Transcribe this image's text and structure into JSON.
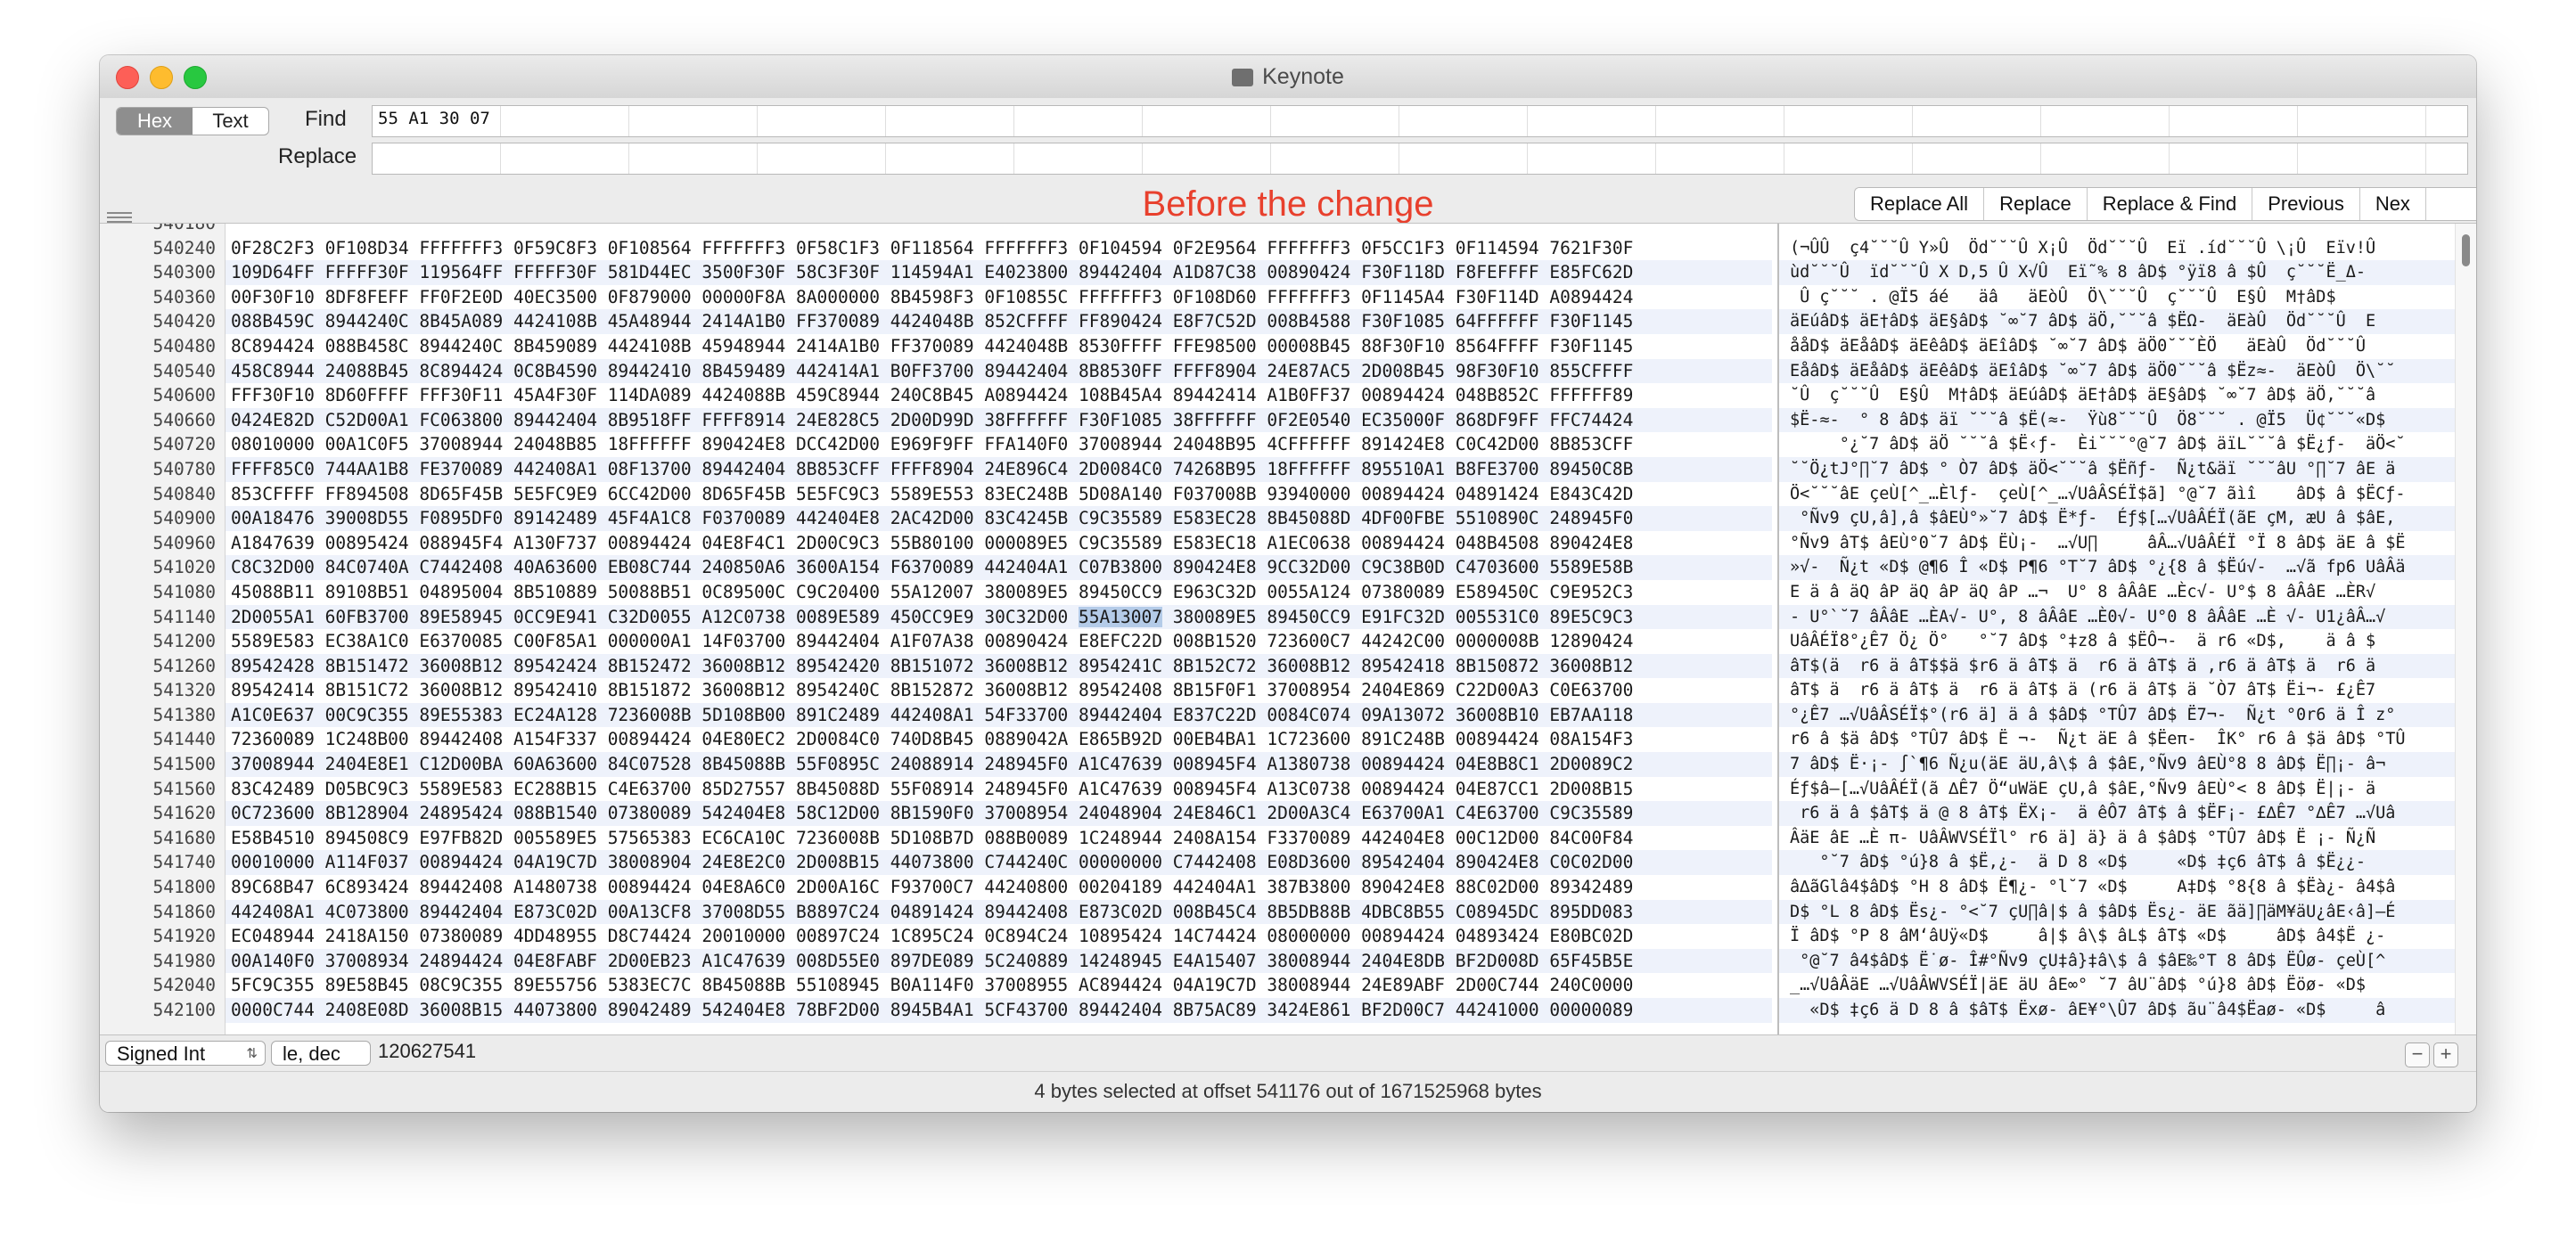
{
  "window": {
    "title": "Keynote"
  },
  "mode_toggle": {
    "hex": "Hex",
    "text": "Text"
  },
  "find": {
    "label": "Find",
    "value": "55 A1 30 07"
  },
  "replace": {
    "label": "Replace",
    "value": ""
  },
  "annotation": "Before the change",
  "actions": {
    "replace_all": "Replace All",
    "replace": "Replace",
    "replace_find": "Replace & Find",
    "previous": "Previous",
    "next": "Nex"
  },
  "hex_view": {
    "first_partial_offset": "540180",
    "offsets": [
      "540240",
      "540300",
      "540360",
      "540420",
      "540480",
      "540540",
      "540600",
      "540660",
      "540720",
      "540780",
      "540840",
      "540900",
      "540960",
      "541020",
      "541080",
      "541140",
      "541200",
      "541260",
      "541320",
      "541380",
      "541440",
      "541500",
      "541560",
      "541620",
      "541680",
      "541740",
      "541800",
      "541860",
      "541920",
      "541980",
      "542040",
      "542100"
    ],
    "hex_rows": [
      "0F28C2F3 0F108D34 FFFFFFF3 0F59C8F3 0F108564 FFFFFFF3 0F58C1F3 0F118564 FFFFFFF3 0F104594 0F2E9564 FFFFFFF3 0F5CC1F3 0F114594 7621F30F",
      "109D64FF FFFFF30F 119564FF FFFFF30F 581D44EC 3500F30F 58C3F30F 114594A1 E4023800 89442404 A1D87C38 00890424 F30F118D F8FEFFFF E85FC62D",
      "00F30F10 8DF8FEFF FF0F2E0D 40EC3500 0F879000 00000F8A 8A000000 8B4598F3 0F10855C FFFFFFF3 0F108D60 FFFFFFF3 0F1145A4 F30F114D A0894424",
      "088B459C 8944240C 8B45A089 4424108B 45A48944 2414A1B0 FF370089 4424048B 852CFFFF FF890424 E8F7C52D 008B4588 F30F1085 64FFFFFF F30F1145",
      "8C894424 088B458C 8944240C 8B459089 4424108B 45948944 2414A1B0 FF370089 4424048B 8530FFFF FFE98500 00008B45 88F30F10 8564FFFF F30F1145",
      "458C8944 24088B45 8C894424 0C8B4590 89442410 8B459489 442414A1 B0FF3700 89442404 8B8530FF FFFF8904 24E87AC5 2D008B45 98F30F10 855CFFFF",
      "FFF30F10 8D60FFFF FFF30F11 45A4F30F 114DA089 4424088B 459C8944 240C8B45 A0894424 108B45A4 89442414 A1B0FF37 00894424 048B852C FFFFFF89",
      "0424E82D C52D00A1 FC063800 89442404 8B9518FF FFFF8914 24E828C5 2D00D99D 38FFFFFF F30F1085 38FFFFFF 0F2E0540 EC35000F 868DF9FF FFC74424",
      "08010000 00A1C0F5 37008944 24048B85 18FFFFFF 890424E8 DCC42D00 E969F9FF FFA140F0 37008944 24048B95 4CFFFFFF 891424E8 C0C42D00 8B853CFF",
      "FFFF85C0 744AA1B8 FE370089 442408A1 08F13700 89442404 8B853CFF FFFF8904 24E896C4 2D0084C0 74268B95 18FFFFFF 895510A1 B8FE3700 89450C8B",
      "853CFFFF FF894508 8D65F45B 5E5FC9E9 6CC42D00 8D65F45B 5E5FC9C3 5589E553 83EC248B 5D08A140 F037008B 93940000 00894424 04891424 E843C42D",
      "00A18476 39008D55 F0895DF0 89142489 45F4A1C8 F0370089 442404E8 2AC42D00 83C4245B C9C35589 E583EC28 8B45088D 4DF00FBE 5510890C 248945F0",
      "A1847639 00895424 088945F4 A130F737 00894424 04E8F4C1 2D00C9C3 55B80100 000089E5 C9C35589 E583EC18 A1EC0638 00894424 048B4508 890424E8",
      "C8C32D00 84C0740A C7442408 40A63600 EB08C744 240850A6 3600A154 F6370089 442404A1 C07B3800 890424E8 9CC32D00 C9C38B0D C4703600 5589E58B",
      "45088B11 89108B51 04895004 8B510889 50088B51 0C89500C C9C20400 55A12007 380089E5 89450CC9 E963C32D 0055A124 07380089 E589450C C9E952C3",
      "2D0055A1 60FB3700 89E58945 0CC9E941 C32D0055 A12C0738 0089E589 450CC9E9 30C32D00 55A13007 380089E5 89450CC9 E91FC32D 005531C0 89E5C9C3",
      "5589E583 EC38A1C0 E6370085 C00F85A1 000000A1 14F03700 89442404 A1F07A38 00890424 E8EFC22D 008B1520 723600C7 44242C00 0000008B 12890424",
      "89542428 8B151472 36008B12 89542424 8B152472 36008B12 89542420 8B151072 36008B12 8954241C 8B152C72 36008B12 89542418 8B150872 36008B12",
      "89542414 8B151C72 36008B12 89542410 8B151872 36008B12 8954240C 8B152872 36008B12 89542408 8B15F0F1 37008954 2404E869 C22D00A3 C0E63700",
      "A1C0E637 00C9C355 89E55383 EC24A128 7236008B 5D108B00 891C2489 442408A1 54F33700 89442404 E837C22D 0084C074 09A13072 36008B10 EB7AA118",
      "72360089 1C248B00 89442408 A154F337 00894424 04E80EC2 2D0084C0 740D8B45 0889042A E865B92D 00EB4BA1 1C723600 891C248B 00894424 08A154F3",
      "37008944 2404E8E1 C12D00BA 60A63600 84C07528 8B45088B 55F0895C 24088914 248945F0 A1C47639 008945F4 A1380738 00894424 04E8B8C1 2D0089C2",
      "83C42489 D05BC9C3 5589E583 EC288B15 C4E63700 85D27557 8B45088D 55F08914 248945F0 A1C47639 008945F4 A13C0738 00894424 04E87CC1 2D008B15",
      "0C723600 8B128904 24895424 088B1540 07380089 542404E8 58C12D00 8B1590F0 37008954 24048904 24E846C1 2D00A3C4 E63700A1 C4E63700 C9C35589",
      "E58B4510 894508C9 E97FB82D 005589E5 57565383 EC6CA10C 7236008B 5D108B7D 088B0089 1C248944 2408A154 F3370089 442404E8 00C12D00 84C00F84",
      "00010000 A114F037 00894424 04A19C7D 38008904 24E8E2C0 2D008B15 44073800 C744240C 00000000 C7442408 E08D3600 89542404 890424E8 C0C02D00",
      "89C68B47 6C893424 89442408 A1480738 00894424 04E8A6C0 2D00A16C F93700C7 44240800 00204189 442404A1 387B3800 890424E8 88C02D00 89342489",
      "442408A1 4C073800 89442404 E873C02D 00A13CF8 37008D55 B8897C24 04891424 89442408 E873C02D 008B45C4 8B5DB88B 4DBC8B55 C08945DC 895DD083",
      "EC048944 2418A150 07380089 4DD48955 D8C74424 20010000 00897C24 1C895C24 0C894C24 10895424 14C74424 08000000 00894424 04893424 E80BC02D",
      "00A140F0 37008934 24894424 04E8FABF 2D00EB23 A1C47639 008D55E0 897DE089 5C240889 14248945 E4A15407 38008944 2404E8DB BF2D008D 65F45B5E",
      "5FC9C355 89E58B45 08C9C355 89E55756 5383EC7C 8B45088B 55108945 B0A114F0 37008955 AC894424 04A19C7D 38008944 24E89ABF 2D00C744 240C0000",
      "0000C744 2408E08D 36008B15 44073800 89042489 542404E8 78BF2D00 8945B4A1 5CF43700 89442404 8B75AC89 3424E861 BF2D00C7 44241000 00000089"
    ],
    "selected_hex": "55A13007",
    "ascii_rows": [
      "(¬ÛÛ  ç4˘˘˘Û Y»Û  Öd˘˘˘Û X¡Û  Öd˘˘˘Û  Eï .íd˘˘˘Û \\¡Û  Eïv!Û",
      "ùd˘˘˘Û  ïd˘˘˘Û X D‚5 Û X√Û  Eï˜% 8 âD$ °ÿï8 â $Û  ç˘˘˘Ë_Δ-",
      " Û ç˘˘˘ . @Ï5 áé   äâ   äEòÛ  Ö\\˘˘˘Û  ç˘˘˘Û  E§Û  M†âD$",
      "äEúâD$ äE†âD$ äE§âD$ ˘∞˘7 âD$ äÖ,˘˘˘â $ËΩ-  äEàÛ  Öd˘˘˘Û  E",
      "ååD$ äEåâD$ äEêâD$ äEîâD$ ˘∞˘7 âD$ äÖ0˘˘˘ÈÖ   äEàÛ  Öd˘˘˘Û",
      "EåâD$ äEåâD$ äEêâD$ äEîâD$ ˘∞˘7 âD$ äÖ0˘˘˘â $Ëz≈-  äEòÛ  Ö\\˘˘",
      "˘Û  ç˘˘˘Û  E§Û  M†âD$ äEúâD$ äE†âD$ äE§âD$ ˘∞˘7 âD$ äÖ,˘˘˘â",
      "$Ë-≈-  ° 8 âD$ äï ˘˘˘â $Ë(≈-  Ÿù8˘˘˘Û  Ö8˘˘˘ . @Ï5  Ü¢˘˘˘«D$",
      "     °¿˘7 âD$ äÖ ˘˘˘â $Ë‹ƒ-  Èi˘˘˘°@˘7 âD$ äïL˘˘˘â $Ë¿ƒ-  äÖ<˘",
      "˘˘Ö¿tJ°∏˘7 âD$ ° Ò7 âD$ äÖ<˘˘˘â $Ëñƒ-  Ñ¿t&äï ˘˘˘âU °∏˘7 âE ä",
      "Ö<˘˘˘âE çeÙ[^_…Èlƒ-  çeÙ[^_…√UâÂSÉÏ$ã] °@˘7 ãìî    âD$ â $ËCƒ-",
      " °Ñv9 çU‚â]‚â $âEÙ°»˘7 âD$ Ë*ƒ-  Éƒ$[…√UâÂÉÏ(ãE çM‚ æU â $âE‚",
      "°Ñv9 âT$ âEÙ°0˘7 âD$ ËÙ¡-  …√U∏     âÂ…√UâÂÉÏ °Ï 8 âD$ äE â $Ë",
      "»√-  Ñ¿t «D$ @¶6 Î «D$ P¶6 °T˘7 âD$ °¿{8 â $Ëú√-  …√ã fp6 UâÂä",
      "E ä â äQ âP äQ âP äQ âP …¬  U° 8 âÂâE …Èc√- U°$ 8 âÂâE …ÈR√",
      "- U°`˘7 âÂâE …ÈA√- U°, 8 âÂâE …È0√- U°0 8 âÂâE …È √- U1¿âÂ…√",
      "UâÂÉÏ8°¿Ê7 Ö¿ Ö°   °˘7 âD$ °‡z8 â $ËÔ¬-  ä r6 «D$,    ä â $",
      "âT$(ä  r6 ä âT$$ä $r6 ä âT$ ä  r6 ä âT$ ä ,r6 ä âT$ ä  r6 ä",
      "âT$ ä  r6 ä âT$ ä  r6 ä âT$ ä (r6 ä âT$ ä ˘Ò7 âT$ Ëi¬- £¿Ê7",
      "°¿Ê7 …√UâÂSÉÏ$°(r6 ä] ä â $âD$ °TÛ7 âD$ Ë7¬-  Ñ¿t °0r6 ä Î z°",
      "r6 â $ä âD$ °TÛ7 âD$ Ë ¬-  Ñ¿t äE â $Ëeπ-  ÎK° r6 â $ä âD$ °TÛ",
      "7 âD$ Ë·¡- ∫`¶6 Ñ¿u(äE äU‚â\\$ â $âE‚°Ñv9 âEÙ°8 8 âD$ Ë∏¡- â¬",
      "Éƒ$â–[…√UâÂÉÏ(ã ∆Ê7 Ö“uWäE çU‚â $âE‚°Ñv9 âEÙ°< 8 âD$ Ë|¡- ä",
      " r6 ä â $âT$ ä @ 8 âT$ ËX¡-  ä êÔ7 âT$ â $ËF¡- £∆Ê7 °∆Ê7 …√Uâ",
      "ÂäE âE …È π- UâÂWVSÉÏl° r6 ä] ä} ä â $âD$ °TÛ7 âD$ Ë ¡- Ñ¿Ñ",
      "   °˘7 âD$ °ú}8 â $Ë‚¿-  ä D 8 «D$     «D$ ‡ç6 âT$ â $Ë¿¿-",
      "â∆ãGlâ4$âD$ °H 8 âD$ Ë¶¿- °l˘7 «D$     A‡D$ °8{8 â $Ëà¿- â4$â",
      "D$ °L 8 âD$ Ës¿- °<˘7 çU∏â|$ â $âD$ Ës¿- äE ãä]∏äM¥äU¿âE‹â]–É",
      "Ï âD$ °P 8 âM‘âUÿ«D$     â|$ â\\$ âL$ âT$ «D$     âD$ â4$Ë ¿-",
      " °@˘7 â4$âD$ Ë˙ø- Î#°Ñv9 çU‡â}‡â\\$ â $âE‰°T 8 âD$ ËÛø- çeÙ[^",
      "_…√UâÂäE …√UâÂWVSÉÏ|äE äU âE∞° ˘7 âU¨âD$ °ú}8 âD$ Ëöø- «D$",
      "  «D$ ‡ç6 ä D 8 â $âT$ Ëxø- âE¥°\\Û7 âD$ ãu¨â4$Ëaø- «D$     â"
    ]
  },
  "inspector": {
    "type": "Signed Int",
    "endian": "le, dec",
    "value": "120627541"
  },
  "status": {
    "text": "4 bytes selected at offset 541176 out of 1671525968 bytes"
  },
  "colors": {
    "annotation": "#e8402d",
    "selection": "#b4cbe8",
    "row_alt": "#eef2fb"
  },
  "icons": {
    "close": "close-window-icon",
    "minimize": "minimize-window-icon",
    "zoom": "zoom-window-icon"
  }
}
